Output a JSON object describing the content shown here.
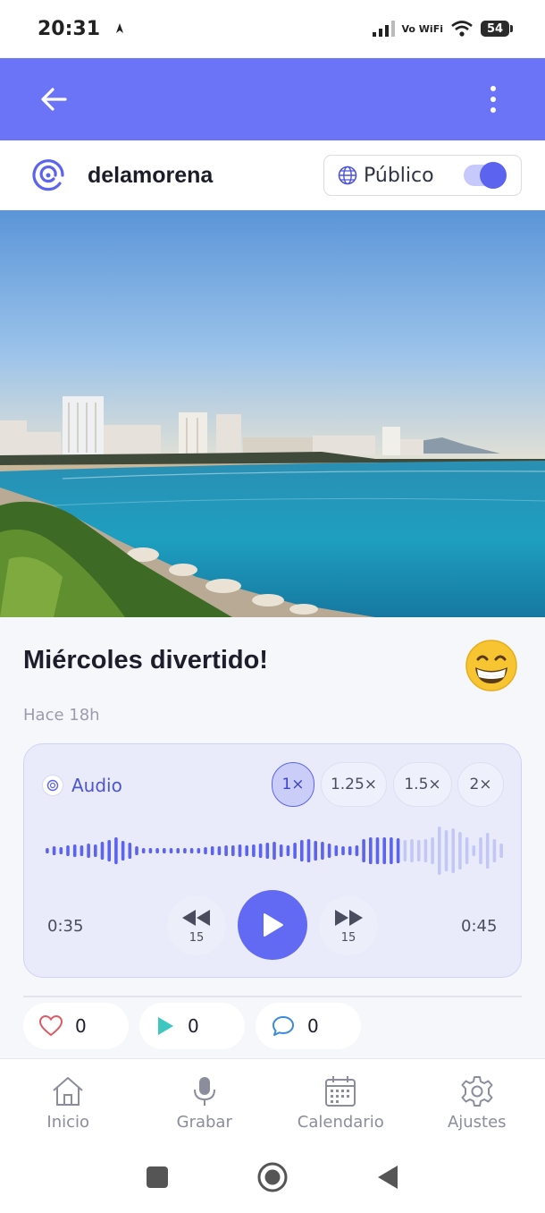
{
  "status_bar": {
    "time": "20:31",
    "network_label": "Vo WiFi",
    "battery": "54"
  },
  "user": {
    "username": "delamorena",
    "visibility_label": "Público"
  },
  "post": {
    "title": "Miércoles divertido!",
    "time_ago": "Hace 18h",
    "emoji": "grinning-face-emoji"
  },
  "audio": {
    "label": "Audio",
    "speeds": [
      "1×",
      "1.25×",
      "1.5×",
      "2×"
    ],
    "selected_speed": "1×",
    "elapsed": "0:35",
    "total": "0:45",
    "rewind_seconds": "15",
    "forward_seconds": "15",
    "progress": 0.78
  },
  "stats": {
    "likes": "0",
    "plays": "0",
    "comments": "0"
  },
  "nav": {
    "items": [
      "Inicio",
      "Grabar",
      "Calendario",
      "Ajustes"
    ]
  },
  "colors": {
    "brand": "#6b74f6",
    "accent": "#5b63ef",
    "like": "#e05a63",
    "play": "#3ec7c0",
    "comment": "#3a8be0"
  }
}
